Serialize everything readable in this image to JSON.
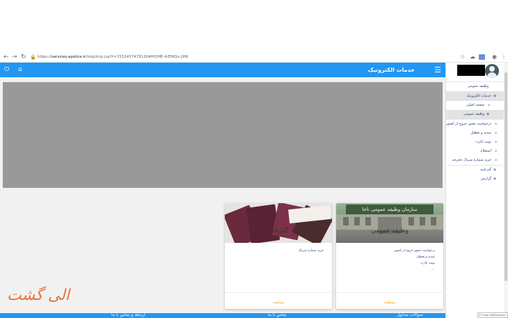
{
  "browser": {
    "url_prefix": "https://",
    "url_domain": "services.epolice.ir",
    "url_path": "/intp/intp.jsp?t=1552457478126#HOME-4/EMQx-J9W",
    "back_icon": "arrow-left",
    "forward_icon": "arrow-right",
    "reload_icon": "reload",
    "lock_icon": "lock"
  },
  "header": {
    "title": "خدمات الکترونیک",
    "menu_icon": "☰",
    "power_icon": "⏻",
    "home_icon": "⌂"
  },
  "sidebar": {
    "items": [
      {
        "label": "وظیفه عمومی",
        "icon": "",
        "highlight": false,
        "sub": false
      },
      {
        "label": "خدمات الکترونیک",
        "icon": "+",
        "highlight": true,
        "sub": false
      },
      {
        "label": "صفحه اصلی",
        "icon": "‹",
        "highlight": false,
        "sub": true
      },
      {
        "label": "وظیفه عمومی",
        "icon": "+",
        "highlight": true,
        "sub": true
      },
      {
        "label": "درخواست مجوز خروج از کشور",
        "icon": "‹",
        "highlight": false,
        "sub": false
      },
      {
        "label": "تمدید و تعطیل",
        "icon": "‹",
        "highlight": false,
        "sub": false
      },
      {
        "label": "نوبت کارت",
        "icon": "‹",
        "highlight": false,
        "sub": false
      },
      {
        "label": "استعلام",
        "icon": "‹",
        "highlight": false,
        "sub": false
      },
      {
        "label": "خرید شماره سریال دفترچه",
        "icon": "‹",
        "highlight": false,
        "sub": false
      },
      {
        "label": "گذرنامه",
        "icon": "+",
        "highlight": false,
        "sub": false
      },
      {
        "label": "گزارش",
        "icon": "+",
        "highlight": false,
        "sub": false
      }
    ]
  },
  "cards": [
    {
      "id": "military",
      "caption": "وظیفه عمومی",
      "sign_text": "سازمان وظیفه عمومی ناجا",
      "items": [
        "درخواست مجوز خروج از کشور",
        "تمدید و تعطیل",
        "نوبت کارت",
        "..."
      ],
      "view_label": "مشاهده"
    },
    {
      "id": "passport",
      "caption": "گذرنامه",
      "items": [
        "خرید شماره سریال"
      ],
      "view_label": "مشاهده"
    }
  ],
  "footer": {
    "left_text": "ارتباط و تماس با ما",
    "center_text": "تماس با ما",
    "right_text": "سوالات متداول"
  },
  "watermark": "الی گشت",
  "notification": "23 new notifications"
}
